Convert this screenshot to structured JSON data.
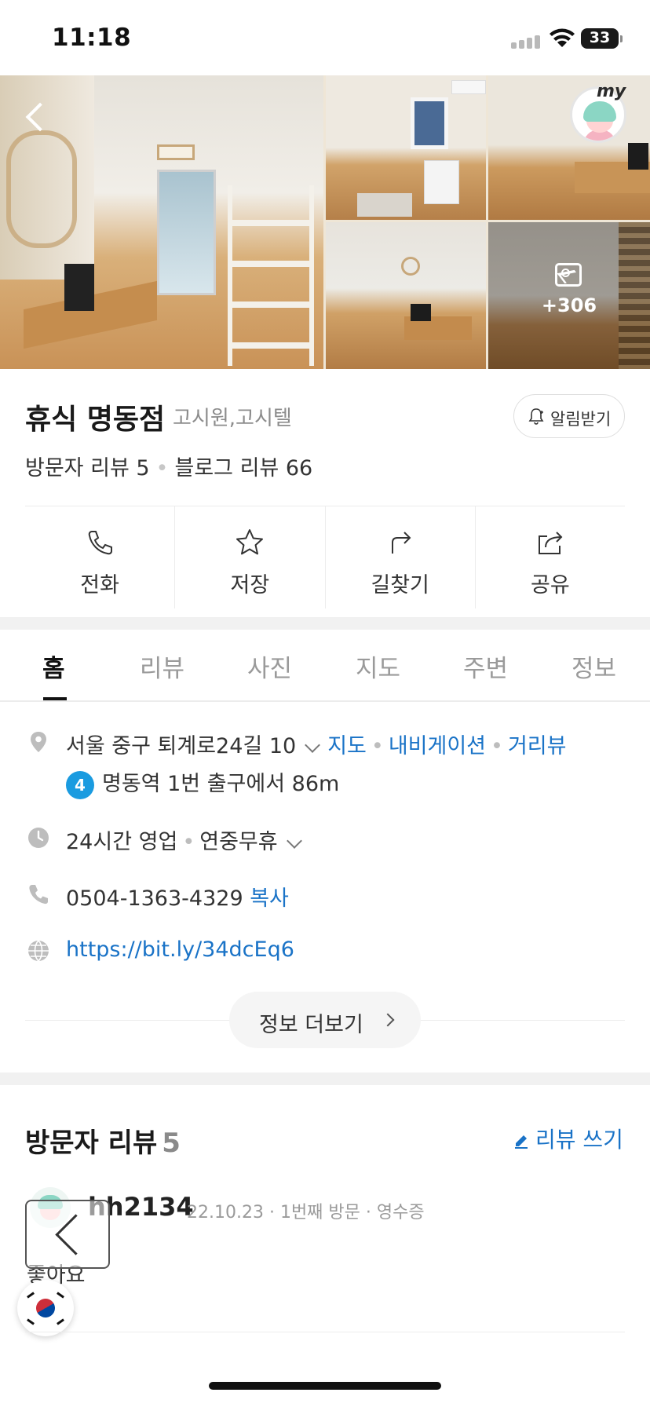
{
  "status_bar": {
    "time": "11:18",
    "battery": "33"
  },
  "gallery": {
    "more_count": "+306",
    "my_label": "my"
  },
  "place": {
    "name": "휴식 명동점",
    "category": "고시원,고시텔",
    "alarm_label": "알림받기",
    "visitor_review": "방문자 리뷰 5",
    "blog_review": "블로그 리뷰 66"
  },
  "actions": [
    {
      "label": "전화",
      "icon": "phone-icon"
    },
    {
      "label": "저장",
      "icon": "star-icon"
    },
    {
      "label": "길찾기",
      "icon": "directions-icon"
    },
    {
      "label": "공유",
      "icon": "share-icon"
    }
  ],
  "tabs": [
    "홈",
    "리뷰",
    "사진",
    "지도",
    "주변",
    "정보"
  ],
  "info": {
    "address": "서울 중구 퇴계로24길 10",
    "map_link": "지도",
    "nav_link": "내비게이션",
    "street_link": "거리뷰",
    "subway_line": "4",
    "subway_text": "명동역 1번 출구에서 86m",
    "hours": "24시간 영업",
    "holiday": "연중무휴",
    "phone": "0504-1363-4329",
    "copy_label": "복사",
    "website": "https://bit.ly/34dcEq6",
    "more_label": "정보 더보기"
  },
  "reviews": {
    "title": "방문자 리뷰",
    "count": "5",
    "write_label": "리뷰 쓰기",
    "items": [
      {
        "user": "hh2134",
        "meta": "22.10.23 · 1번째 방문 · 영수증",
        "text": "좋아요"
      }
    ]
  },
  "colors": {
    "link": "#1a73c7",
    "subway_line4": "#1a9be0"
  }
}
